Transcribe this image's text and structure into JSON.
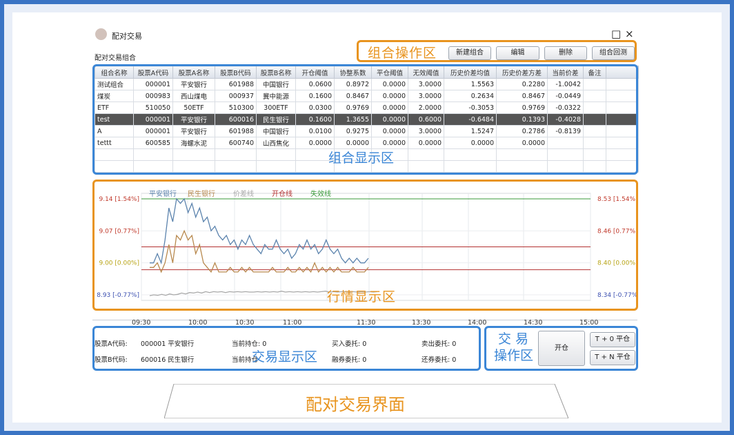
{
  "window": {
    "title": "配对交易",
    "subtitle": "配对交易组合",
    "ctrl_max": "□",
    "ctrl_close": "×"
  },
  "labels": {
    "ops": "组合操作区",
    "grid": "组合显示区",
    "market": "行情显示区",
    "trade_display": "交易显示区",
    "trade_ops_1": "交 易",
    "trade_ops_2": "操作区",
    "caption": "配对交易界面"
  },
  "toolbar": {
    "new": "新建组合",
    "edit": "编辑",
    "delete": "删除",
    "backtest": "组合回测"
  },
  "table": {
    "columns": [
      "组合名称",
      "股票A代码",
      "股票A名称",
      "股票B代码",
      "股票B名称",
      "开仓阈值",
      "协整系数",
      "平仓阈值",
      "无效阈值",
      "历史价差均值",
      "历史价差方差",
      "当前价差",
      "备注"
    ],
    "rows": [
      [
        "测试组合",
        "000001",
        "平安银行",
        "601988",
        "中国银行",
        "0.0600",
        "0.8972",
        "0.0000",
        "3.0000",
        "1.5563",
        "0.2280",
        "-1.0042",
        ""
      ],
      [
        "煤炭",
        "000983",
        "西山煤电",
        "000937",
        "冀中能源",
        "0.1600",
        "0.8467",
        "0.0000",
        "3.0000",
        "0.2634",
        "0.8467",
        "-0.0449",
        ""
      ],
      [
        "ETF",
        "510050",
        "50ETF",
        "510300",
        "300ETF",
        "0.0300",
        "0.9769",
        "0.0000",
        "2.0000",
        "-0.3053",
        "0.9769",
        "-0.0322",
        ""
      ],
      [
        "test",
        "000001",
        "平安银行",
        "600016",
        "民生银行",
        "0.1600",
        "1.3655",
        "0.0000",
        "0.6000",
        "-0.6484",
        "0.1393",
        "-0.4028",
        ""
      ],
      [
        "A",
        "000001",
        "平安银行",
        "601988",
        "中国银行",
        "0.0100",
        "0.9275",
        "0.0000",
        "3.0000",
        "1.5247",
        "0.2786",
        "-0.8139",
        ""
      ],
      [
        "tettt",
        "600585",
        "海螺水泥",
        "600740",
        "山西焦化",
        "0.0000",
        "0.0000",
        "0.0000",
        "0.0000",
        "0.0000",
        "0.0000",
        "",
        ""
      ],
      [
        "",
        "",
        "",
        "",
        "",
        "",
        "",
        "",
        "",
        "",
        "",
        "",
        ""
      ],
      [
        "",
        "",
        "",
        "",
        "",
        "",
        "",
        "",
        "",
        "",
        "",
        "",
        ""
      ]
    ],
    "selected_row": 3
  },
  "chart_data": {
    "type": "line",
    "legend": [
      "平安银行",
      "民生银行",
      "价差线",
      "开仓线",
      "失效线"
    ],
    "colors": {
      "a": "#5b83ad",
      "b": "#b8894e",
      "spread": "#a8a8a8",
      "open": "#b33030",
      "invalid": "#3a9a3a"
    },
    "left_ticks": [
      "9.14 [1.54%]",
      "9.07 [0.77%]",
      "9.00 [0.00%]",
      "8.93 [-0.77%]"
    ],
    "right_ticks": [
      "8.53 [1.54%",
      "8.46 [0.77%",
      "8.40 [0.00%",
      "8.34 [-0.77%"
    ],
    "x_ticks": [
      "09:30",
      "10:00",
      "10:30",
      "11:00",
      "11:30",
      "13:30",
      "14:00",
      "14:30",
      "15:00"
    ],
    "left_ylim": [
      8.93,
      9.14
    ],
    "levels": {
      "invalid": 9.14,
      "open_upper": 9.035,
      "open_lower": 8.985
    },
    "series": [
      {
        "name": "平安银行",
        "values": [
          9.0,
          9.0,
          9.02,
          9.0,
          9.05,
          9.12,
          9.09,
          9.14,
          9.13,
          9.14,
          9.11,
          9.13,
          9.1,
          9.12,
          9.09,
          9.1,
          9.07,
          9.08,
          9.06,
          9.05,
          9.06,
          9.04,
          9.05,
          9.03,
          9.05,
          9.04,
          9.06,
          9.04,
          9.03,
          9.02,
          9.04,
          9.03,
          9.03,
          9.05,
          9.03,
          9.02,
          9.03,
          9.01,
          9.02,
          9.04,
          9.03,
          9.05,
          9.03,
          9.04,
          9.02,
          9.03,
          9.05,
          9.03,
          9.02,
          9.03,
          9.01,
          9.0,
          9.01,
          9.0,
          9.01,
          9.0,
          9.0,
          9.01
        ]
      },
      {
        "name": "民生银行",
        "values": [
          8.99,
          8.99,
          9.0,
          8.98,
          9.0,
          9.04,
          9.0,
          9.06,
          9.05,
          9.07,
          9.05,
          9.06,
          9.02,
          9.04,
          9.0,
          8.99,
          8.98,
          9.0,
          8.98,
          8.98,
          8.98,
          8.99,
          8.98,
          8.98,
          8.99,
          8.98,
          8.99,
          8.98,
          8.98,
          8.98,
          8.98,
          8.98,
          8.99,
          8.98,
          8.98,
          8.98,
          8.99,
          8.98,
          8.98,
          8.99,
          8.98,
          8.99,
          8.98,
          9.0,
          8.98,
          8.99,
          8.98,
          8.99,
          8.98,
          8.99,
          8.98,
          8.98,
          8.98,
          8.99,
          8.98,
          8.98,
          8.98,
          8.99
        ]
      },
      {
        "name": "价差线",
        "values": [
          8.928,
          8.93,
          8.929,
          8.931,
          8.929,
          8.932,
          8.93,
          8.931,
          8.934,
          8.932,
          8.935,
          8.934,
          8.936,
          8.934,
          8.937,
          8.935,
          8.937,
          8.936,
          8.937,
          8.935,
          8.937,
          8.936,
          8.937,
          8.936,
          8.937,
          8.936,
          8.936,
          8.937,
          8.936,
          8.937,
          8.936,
          8.937,
          8.936,
          8.938,
          8.936,
          8.937,
          8.936,
          8.937,
          8.936,
          8.937,
          8.936,
          8.937,
          8.936,
          8.937,
          8.938,
          8.936,
          8.937,
          8.936,
          8.937,
          8.937,
          8.936,
          8.937,
          8.936,
          8.937,
          8.936,
          8.937,
          8.936,
          8.937
        ]
      }
    ]
  },
  "trade_info": {
    "stock_a_label": "股票A代码:",
    "stock_a_value": "000001 平安银行",
    "stock_b_label": "股票B代码:",
    "stock_b_value": "600016 民生银行",
    "position_a": "当前持仓: 0",
    "position_b": "当前持仓",
    "buy_order": "买入委托: 0",
    "margin_order": "融券委托: 0",
    "sell_order": "卖出委托: 0",
    "repay_order": "还券委托: 0"
  },
  "trade_buttons": {
    "open": "开仓",
    "t0": "T + 0 平仓",
    "tn": "T + N 平仓"
  }
}
